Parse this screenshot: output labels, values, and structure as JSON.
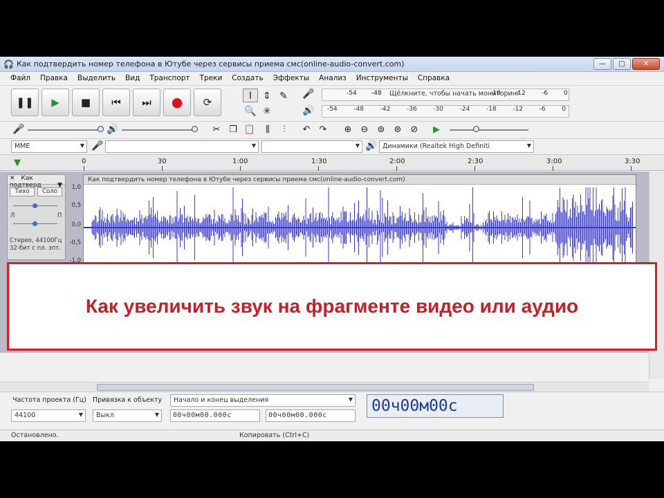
{
  "window": {
    "title": "Как подтвердить номер телефона в Ютубе через сервисы приема смс(online-audio-convert.com)",
    "minimize": "—",
    "maximize": "□",
    "close": "✕"
  },
  "menu": [
    "Файл",
    "Правка",
    "Выделить",
    "Вид",
    "Транспорт",
    "Треки",
    "Создать",
    "Эффекты",
    "Анализ",
    "Инструменты",
    "Справка"
  ],
  "transport": {
    "pause_icon": "pause-icon",
    "play_icon": "play-icon",
    "stop_icon": "stop-icon",
    "skip_start_icon": "skip-to-start-icon",
    "skip_end_icon": "skip-to-end-icon",
    "record_icon": "record-icon",
    "loop_icon": "loop-icon"
  },
  "meters": {
    "record_scale": [
      "-54",
      "-48"
    ],
    "record_hint": "Щёлкните, чтобы начать мониторинг",
    "record_scale_right": [
      "-18",
      "-12",
      "-6",
      "0"
    ],
    "play_scale": [
      "-54",
      "-48",
      "-42",
      "-36",
      "-30",
      "-24",
      "-18",
      "-12",
      "-6",
      "0"
    ]
  },
  "devices": {
    "host": "MME",
    "input": "",
    "channels": "",
    "output": "Динамики (Realtek High Definiti"
  },
  "ruler": {
    "ticks": [
      "0",
      "30",
      "1:00",
      "1:30",
      "2:00",
      "2:30",
      "3:00",
      "3:30"
    ]
  },
  "track": {
    "name": "Как подтверд",
    "close": "✕",
    "mute": "Тихо",
    "solo": "Соло",
    "left": "Л",
    "right": "П",
    "info": "Стерео, 44100Гц 32-бит с пл. зпт.",
    "clip_title": "Как подтвердить номер телефона в Ютубе через сервисы приема смс(online-audio-convert.com)",
    "scale": [
      "1,0",
      "0,5",
      "0,0",
      "-0,5",
      "-1,0"
    ]
  },
  "banner": {
    "text": "Как увеличить звук на фрагменте видео или аудио"
  },
  "selection": {
    "rate_label": "Частота проекта (Гц)",
    "snap_label": "Привязка к объекту",
    "range_label": "Начало и конец выделения",
    "rate_value": "44100",
    "snap_value": "Выкл",
    "start_time": "00ч00м00.000с",
    "end_time": "00ч00м00.000с",
    "big_time": "00ч00м00с"
  },
  "status": {
    "left": "Остановлено.",
    "center": "Копировать (Ctrl+C)"
  }
}
